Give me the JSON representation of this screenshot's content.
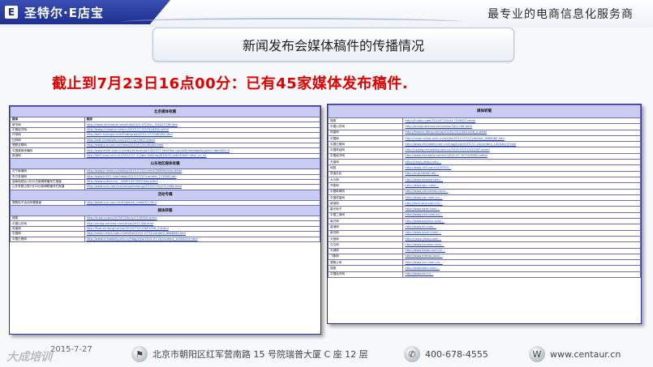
{
  "header": {
    "logo_icon": "E",
    "logo_text": "圣特尔·E店宝",
    "slogan": "最专业的电商信息化服务商"
  },
  "title": "新闻发布会媒体稿件的传播情况",
  "headline": "截止到7月23日16点00分：已有45家媒体发布稿件.",
  "left_table": {
    "section1": "北京媒体有稿",
    "col_media": "媒体",
    "col_link": "链接",
    "rows1": [
      [
        "新华网",
        "http://news.xinhuanet.com/info/2015-07/20/c_134427738.htm"
      ],
      [
        "中国经济网",
        "http://www.chinaeco.com/cn/2015-07-20/7418340.shtml"
      ],
      [
        "环球网",
        "http://tech.huanqiu.com/Enterprise/2015-07/7046183.html"
      ],
      [
        "比特网",
        "http://soft.chinabyte.com/327/13475627.shtml"
      ],
      [
        "慧聪互联网",
        "http://www.yun.com.cn/news/2015/0720/40083.html"
      ],
      [
        "中国营销传播网",
        "http://www.emkt.com.cn/news/ec/ecomat/1062075.html?ba=social&message&typeid=detail&f=0"
      ],
      [
        "新浪网",
        "http://tech.sina.com.cn/i/2015-07-21/doc-ifxfvrsw2818132.shtml?arcf=tech_cc_v2"
      ]
    ],
    "section2": "山东地区媒体有稿",
    "rows2": [
      [
        "济宁新闻网",
        "http://www.jnnews.tv/caijing/2015-07/21/cms476065article.shtml"
      ],
      [
        "东方圣城网",
        "http://www.jn001.com/news/2015-07/21/content_121806.htm"
      ],
      [
        "曲阜电视台7月20日新闻联播专栏报道",
        "http://www.qufutv.cn/.../VIDE1437520154a.shtml"
      ],
      [
        "山东有限卫视7月20日新闻联播专栏报道",
        "http://www.iqilu.com/v/a/mingshizheng/2015/0720/2722566.html"
      ]
    ],
    "section3": "活动专稿",
    "rows3": [
      [
        "慧聪电子活动专题报道",
        "http://www.yun.com.cn/zt/special_meet/51.html"
      ]
    ],
    "section4": "媒体转载",
    "rows4": [
      [
        "搜狐",
        "http://it.sohu.com/20150720/n417139502.shtml"
      ],
      [
        "中国山东网",
        "http://sinaig.sdchina.com/show/3421166.html"
      ],
      [
        "凤凰网",
        "http://finance.ifeng.com/a/20150720/13851456_0.shtml"
      ],
      [
        "中国网",
        "http://union.china.com.cn/md/txt/2015-07/21/content_8088060.htm"
      ],
      [
        "中国日报网",
        "http://www.chinadaily.com.cn/hqgj/jryw/2015-07-20/content_14004014.html"
      ]
    ]
  },
  "right_table": {
    "section": "媒体转载",
    "rows": [
      [
        "搜狐",
        "http://it.sohu.com/20150720/n417139502.shtml"
      ],
      [
        "中国山东网",
        "http://sinaig.sdchina.com/show/3421166.html"
      ],
      [
        "凤凰网",
        "http://finance.ifeng.com/a/20150720/13851456_0.shtml"
      ],
      [
        "中国网",
        "http://union.china.com.cn/md/txt/2015-07/21/content_8088060.htm"
      ],
      [
        "中国日报网",
        "http://www.chinadaily.com.cn/hqgj/jryw/2015-07-20/content_14004014.html"
      ],
      [
        "中国财经网",
        "http://caijing.chinadaily.com.cn/2015-07/21/422287.shtml"
      ],
      [
        "中国经济网",
        "http://www.chinaeco.com/cn/2015-07-20/7418340.shtml"
      ],
      [
        "天极网",
        "http://news.yesky.com/..."
      ],
      [
        "网易",
        "http://www.163.com/15/0720/..."
      ],
      [
        "凯迪社区",
        "http://club.kdnet.net/..."
      ],
      [
        "大众网",
        "http://www.dzwww.com/..."
      ],
      [
        "齐鲁网",
        "http://www.iqilu.com/..."
      ],
      [
        "中国新闻网",
        "http://www.chinanews.com/..."
      ],
      [
        "中国质量网",
        "http://www.cqn.com.cn/..."
      ],
      [
        "新浪网",
        "http://tech.sina.com.cn/..."
      ],
      [
        "星光电子",
        "http://www.xgdz.com/..."
      ],
      [
        "中国工商网",
        "http://www.cicn.com.cn/..."
      ],
      [
        "南方网",
        "http://www.southcn.com/..."
      ],
      [
        "香港网",
        "http://www.hk.com/..."
      ],
      [
        "新世网",
        "http://www.xinshi.com/..."
      ],
      [
        "天极网",
        "http://news.yesky.com/..."
      ],
      [
        "汉文网",
        "http://www.hanwen.com/..."
      ],
      [
        "长城网",
        "http://www.hebei.com.cn/..."
      ],
      [
        "飞象网",
        "http://www.cctime.com/..."
      ],
      [
        "慧聪公司",
        "http://www.yun.com.cn/..."
      ],
      [
        "搜狐",
        "http://www.sohu.com/..."
      ],
      [
        "中国经济网",
        "http://www.ce.cn/..."
      ]
    ]
  },
  "footer": {
    "watermark": "大成培训",
    "date": "2015-7-27",
    "address": "北京市朝阳区红军营南路 15 号院瑞普大厦 C 座 12 层",
    "phone": "400-678-4555",
    "website": "www.centaur.cn",
    "location_icon": "location-icon",
    "phone_icon": "phone-icon",
    "globe_icon": "globe-icon"
  },
  "colors": {
    "logo_blue": "#1e2f8f",
    "headline_red": "#e00000",
    "section_bg": "#c9ccf2",
    "link_blue": "#1b3fb5"
  }
}
